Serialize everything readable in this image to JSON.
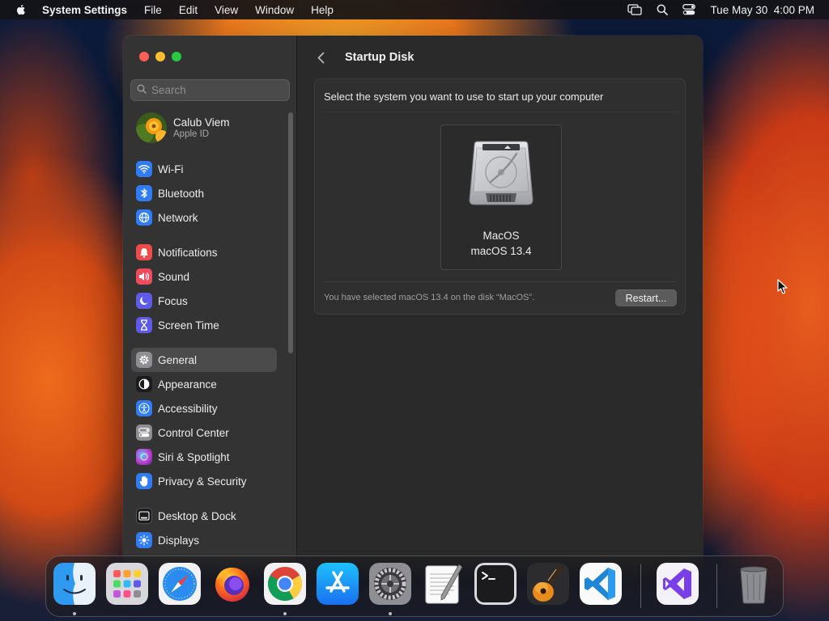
{
  "menubar": {
    "app_name": "System Settings",
    "menus": [
      "File",
      "Edit",
      "View",
      "Window",
      "Help"
    ],
    "clock": "Tue May 30  4:00 PM",
    "icons": [
      "apple-icon",
      "screen-mirroring-icon",
      "spotlight-search-icon",
      "control-center-icon"
    ]
  },
  "sidebar": {
    "search_placeholder": "Search",
    "account": {
      "name": "Calub Viem",
      "subtitle": "Apple ID"
    },
    "items": [
      {
        "label": "Wi-Fi",
        "icon": "wifi-icon",
        "color": "#2f7cf6"
      },
      {
        "label": "Bluetooth",
        "icon": "bluetooth-icon",
        "color": "#2f7cf6"
      },
      {
        "label": "Network",
        "icon": "globe-icon",
        "color": "#2f7cf6"
      },
      {
        "label": "Notifications",
        "icon": "bell-icon",
        "color": "#ee4b4b"
      },
      {
        "label": "Sound",
        "icon": "speaker-icon",
        "color": "#ee4b5f"
      },
      {
        "label": "Focus",
        "icon": "moon-icon",
        "color": "#5e5ce6"
      },
      {
        "label": "Screen Time",
        "icon": "hourglass-icon",
        "color": "#5e5ce6"
      },
      {
        "label": "General",
        "icon": "gear-icon",
        "color": "#8e8e93",
        "selected": true
      },
      {
        "label": "Appearance",
        "icon": "appearance-icon",
        "color": "#1c1c1e"
      },
      {
        "label": "Accessibility",
        "icon": "accessibility-icon",
        "color": "#2f7cf6"
      },
      {
        "label": "Control Center",
        "icon": "control-center-icon",
        "color": "#8e8e93"
      },
      {
        "label": "Siri & Spotlight",
        "icon": "siri-icon",
        "color": "#c23bd0"
      },
      {
        "label": "Privacy & Security",
        "icon": "hand-icon",
        "color": "#2f7cf6"
      },
      {
        "label": "Desktop & Dock",
        "icon": "dock-icon",
        "color": "#1c1c1e"
      },
      {
        "label": "Displays",
        "icon": "sun-icon",
        "color": "#2f7cf6"
      }
    ]
  },
  "content": {
    "title": "Startup Disk",
    "instruction": "Select the system you want to use to start up your computer",
    "disk": {
      "name": "MacOS",
      "version": "macOS 13.4"
    },
    "status": "You have selected macOS 13.4 on the disk “MacOS”.",
    "restart_label": "Restart..."
  },
  "dock": {
    "apps": [
      "Finder",
      "Launchpad",
      "Safari",
      "Firefox",
      "Google Chrome",
      "App Store",
      "System Settings",
      "TextEdit",
      "Terminal",
      "GarageBand",
      "Visual Studio Code",
      "Visual Studio",
      "Trash"
    ]
  }
}
